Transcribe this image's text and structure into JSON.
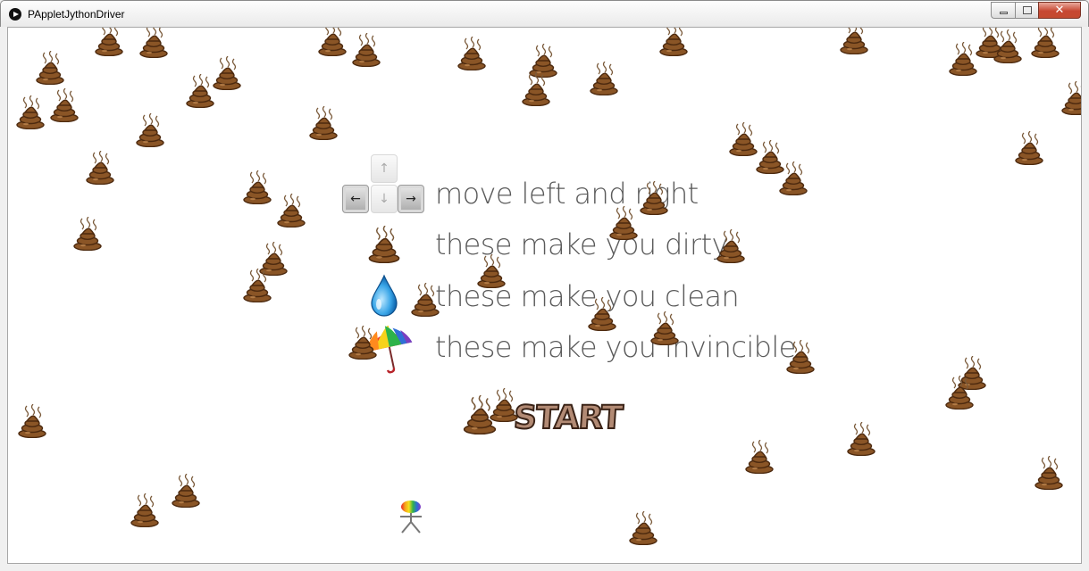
{
  "window": {
    "title": "PAppletJythonDriver",
    "close_glyph": "✕"
  },
  "instructions": {
    "move": "move left and right",
    "dirty": "these make you dirty",
    "clean": "these make you clean",
    "invincible": "these make you invincible"
  },
  "keys": {
    "up": "↑",
    "left": "←",
    "down": "↓",
    "right": "→"
  },
  "start_label": "START",
  "icons": {
    "poo": "poo-icon",
    "water-drop": "water-drop-icon",
    "umbrella": "rainbow-umbrella-icon",
    "player": "player-character"
  },
  "colors": {
    "poo_body": "#8a5526",
    "poo_outline": "#4d2a0f",
    "text": "#5a5a5a",
    "start_fill": "#b28a74"
  }
}
